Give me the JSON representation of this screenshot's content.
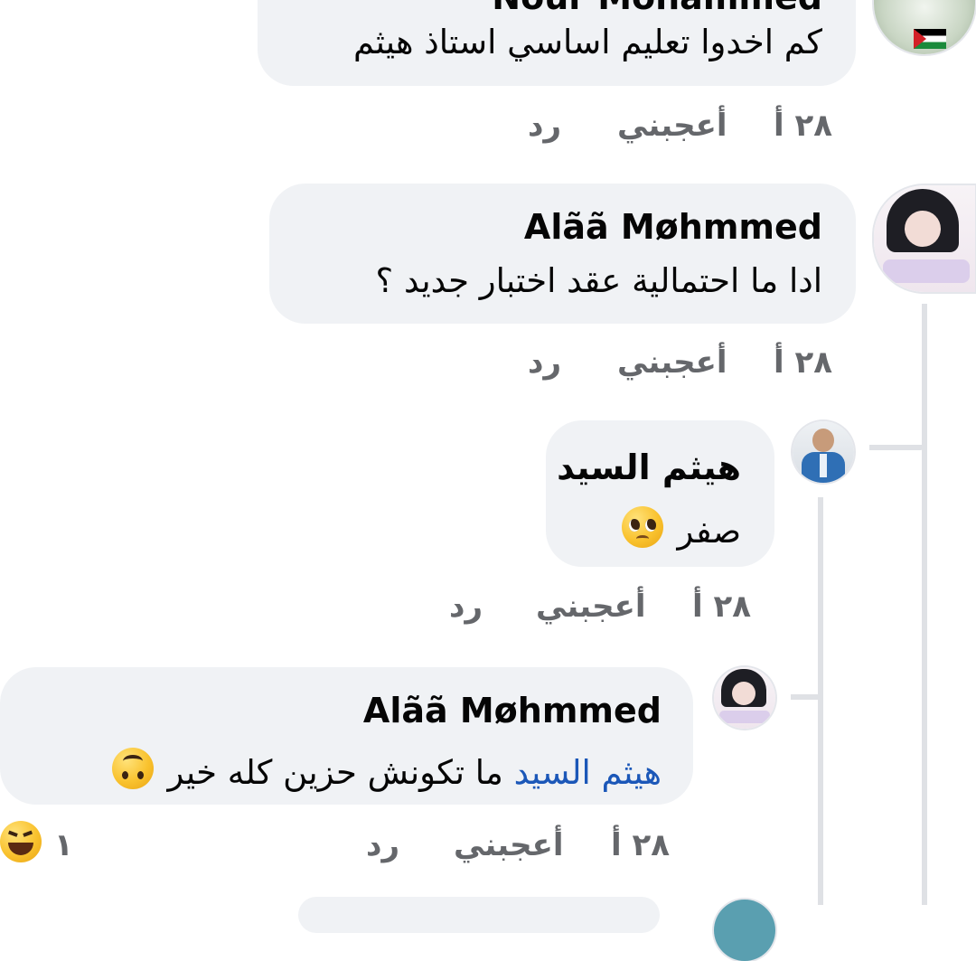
{
  "comments": [
    {
      "author": "Nour Mohammed",
      "text": "كم اخدوا تعليم اساسي استاذ هيثم",
      "time": "٢٨ أ",
      "like_label": "أعجبني",
      "reply_label": "رد"
    },
    {
      "author": "Alãã Møhmmed",
      "text": "ادا ما احتمالية عقد اختبار جديد ؟",
      "time": "٢٨ أ",
      "like_label": "أعجبني",
      "reply_label": "رد"
    },
    {
      "author": "هيثم السيد",
      "text": "صفر",
      "emoji": "pleading-face-emoji",
      "time": "٢٨ أ",
      "like_label": "أعجبني",
      "reply_label": "رد"
    },
    {
      "author": "Alãã Møhmmed",
      "mention": "هيثم السيد",
      "text": "ما تكونش حزين كله خير",
      "emoji": "upside-down-face-emoji",
      "time": "٢٨ أ",
      "like_label": "أعجبني",
      "reply_label": "رد",
      "reaction": {
        "emoji": "laughing-face-emoji",
        "count": "١"
      }
    }
  ],
  "colors": {
    "bubble": "#f0f2f5",
    "meta": "#65676b",
    "mention": "#1b57b8",
    "thread_line": "#dfe1e5"
  }
}
